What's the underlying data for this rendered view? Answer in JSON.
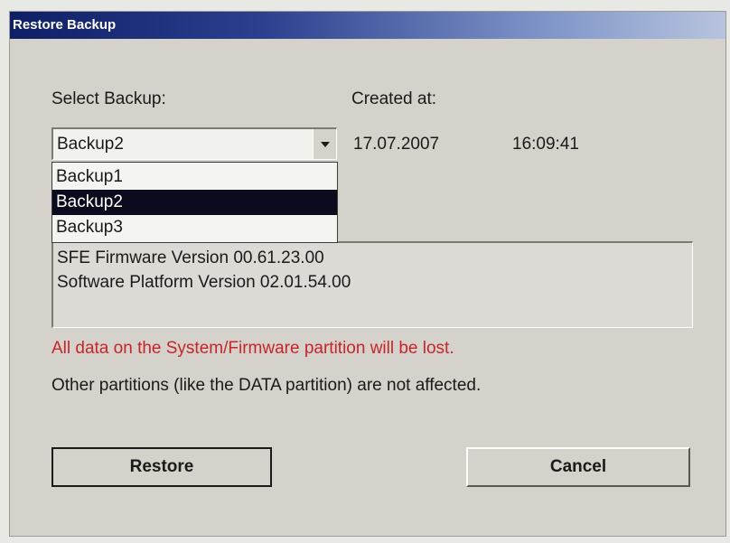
{
  "dialog": {
    "title": "Restore Backup"
  },
  "select_backup": {
    "label": "Select Backup:",
    "selected": "Backup2",
    "options": [
      "Backup1",
      "Backup2",
      "Backup3"
    ],
    "highlighted_index": 1
  },
  "created_at": {
    "label": "Created at:",
    "date": "17.07.2007",
    "time": "16:09:41"
  },
  "info": {
    "lines": [
      "SFE Firmware Version 00.61.23.00",
      "Software Platform Version 02.01.54.00"
    ]
  },
  "messages": {
    "warning": "All data on the System/Firmware partition will be lost.",
    "note": "Other partitions (like the DATA partition) are not affected."
  },
  "buttons": {
    "restore": "Restore",
    "cancel": "Cancel"
  },
  "colors": {
    "warning": "#c8242a",
    "title_bar": "#0f1f66",
    "selection": "#0b0b1e"
  },
  "icons": {
    "dropdown": "chevron-down-icon"
  }
}
